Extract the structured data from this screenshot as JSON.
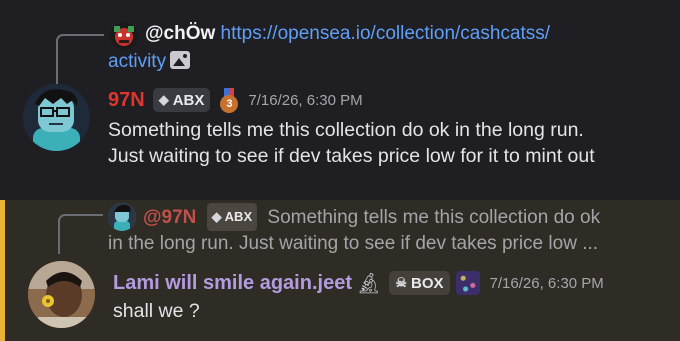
{
  "message1": {
    "reply": {
      "author": "@chÖw",
      "link_text_line1": "https://opensea.io/collection/cashcatss/",
      "link_text_line2": "activity",
      "attachment_icon": "image-icon"
    },
    "author": "97N",
    "role_tag": "ABX",
    "badge_icon": "bronze-medal-icon",
    "timestamp": "7/16/26, 6:30 PM",
    "text_line1": "Something tells me this collection do ok in the long run.",
    "text_line2": "Just waiting to see if dev takes price low for it to mint out"
  },
  "message2": {
    "reply": {
      "author": "@97N",
      "role_tag": "ABX",
      "text_line1": "Something tells me this collection do ok",
      "text_line2": "in the long run. Just waiting to see if dev takes price low ..."
    },
    "author": "Lami will smile again.jeet",
    "author_icon": "microscope-icon",
    "role_tag": "BOX",
    "role_icon": "skull-icon",
    "badge_icon": "pixel-art-icon",
    "timestamp": "7/16/26, 6:30 PM",
    "text": "shall we ?",
    "highlight_color": "#e7b437"
  },
  "colors": {
    "background": "#1f1f23",
    "highlight_background": "#2f2b25",
    "link": "#5f9ff5",
    "name_red": "#e0352d",
    "name_purple": "#b39be0"
  }
}
